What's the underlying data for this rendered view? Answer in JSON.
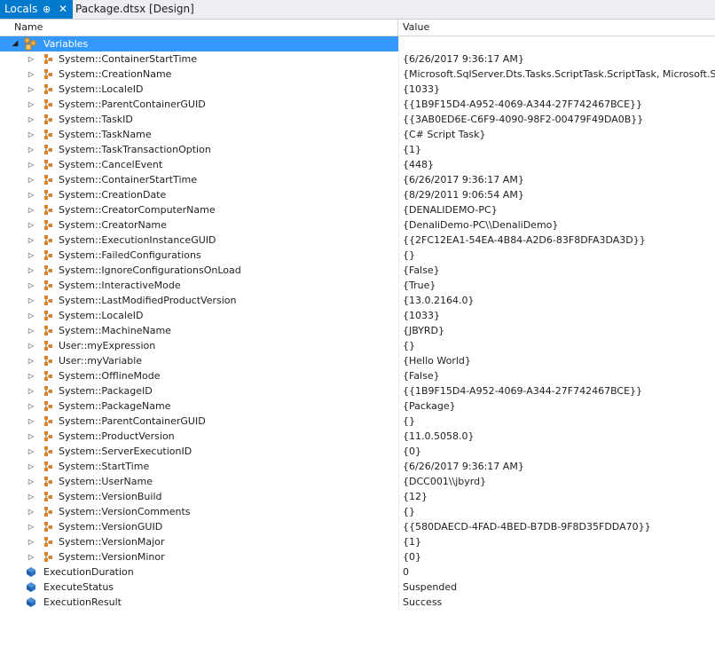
{
  "tabs": {
    "locals": "Locals",
    "pin": "⊕",
    "close": "✕",
    "document": "Package.dtsx [Design]"
  },
  "columns": {
    "name": "Name",
    "value": "Value"
  },
  "root": {
    "name": "Variables",
    "value": ""
  },
  "variables": [
    {
      "name": "System::ContainerStartTime",
      "value": "{6/26/2017 9:36:17 AM}"
    },
    {
      "name": "System::CreationName",
      "value": "{Microsoft.SqlServer.Dts.Tasks.ScriptTask.ScriptTask, Microsoft.SqlS"
    },
    {
      "name": "System::LocaleID",
      "value": "{1033}"
    },
    {
      "name": "System::ParentContainerGUID",
      "value": "{{1B9F15D4-A952-4069-A344-27F742467BCE}}"
    },
    {
      "name": "System::TaskID",
      "value": "{{3AB0ED6E-C6F9-4090-98F2-00479F49DA0B}}"
    },
    {
      "name": "System::TaskName",
      "value": "{C# Script Task}"
    },
    {
      "name": "System::TaskTransactionOption",
      "value": "{1}"
    },
    {
      "name": "System::CancelEvent",
      "value": "{448}"
    },
    {
      "name": "System::ContainerStartTime",
      "value": "{6/26/2017 9:36:17 AM}"
    },
    {
      "name": "System::CreationDate",
      "value": "{8/29/2011 9:06:54 AM}"
    },
    {
      "name": "System::CreatorComputerName",
      "value": "{DENALIDEMO-PC}"
    },
    {
      "name": "System::CreatorName",
      "value": "{DenaliDemo-PC\\\\DenaliDemo}"
    },
    {
      "name": "System::ExecutionInstanceGUID",
      "value": "{{2FC12EA1-54EA-4B84-A2D6-83F8DFA3DA3D}}"
    },
    {
      "name": "System::FailedConfigurations",
      "value": "{}"
    },
    {
      "name": "System::IgnoreConfigurationsOnLoad",
      "value": "{False}"
    },
    {
      "name": "System::InteractiveMode",
      "value": "{True}"
    },
    {
      "name": "System::LastModifiedProductVersion",
      "value": "{13.0.2164.0}"
    },
    {
      "name": "System::LocaleID",
      "value": "{1033}"
    },
    {
      "name": "System::MachineName",
      "value": "{JBYRD}"
    },
    {
      "name": "User::myExpression",
      "value": "{}"
    },
    {
      "name": "User::myVariable",
      "value": "{Hello World}"
    },
    {
      "name": "System::OfflineMode",
      "value": "{False}"
    },
    {
      "name": "System::PackageID",
      "value": "{{1B9F15D4-A952-4069-A344-27F742467BCE}}"
    },
    {
      "name": "System::PackageName",
      "value": "{Package}"
    },
    {
      "name": "System::ParentContainerGUID",
      "value": "{}"
    },
    {
      "name": "System::ProductVersion",
      "value": "{11.0.5058.0}"
    },
    {
      "name": "System::ServerExecutionID",
      "value": "{0}"
    },
    {
      "name": "System::StartTime",
      "value": "{6/26/2017 9:36:17 AM}"
    },
    {
      "name": "System::UserName",
      "value": "{DCC001\\\\jbyrd}"
    },
    {
      "name": "System::VersionBuild",
      "value": "{12}"
    },
    {
      "name": "System::VersionComments",
      "value": "{}"
    },
    {
      "name": "System::VersionGUID",
      "value": "{{580DAECD-4FAD-4BED-B7DB-9F8D35FDDA70}}"
    },
    {
      "name": "System::VersionMajor",
      "value": "{1}"
    },
    {
      "name": "System::VersionMinor",
      "value": "{0}"
    }
  ],
  "results": [
    {
      "name": "ExecutionDuration",
      "value": "0"
    },
    {
      "name": "ExecuteStatus",
      "value": "Suspended"
    },
    {
      "name": "ExecutionResult",
      "value": "Success"
    }
  ],
  "icons": {
    "variable": "variable-icon",
    "field": "field-icon",
    "expand": "expand-arrow-icon",
    "collapse": "collapse-arrow-icon"
  },
  "colors": {
    "selection": "#3399ff",
    "tab_active": "#007acc",
    "variable_icon": "#d9822b",
    "field_icon": "#1f5fa8"
  }
}
